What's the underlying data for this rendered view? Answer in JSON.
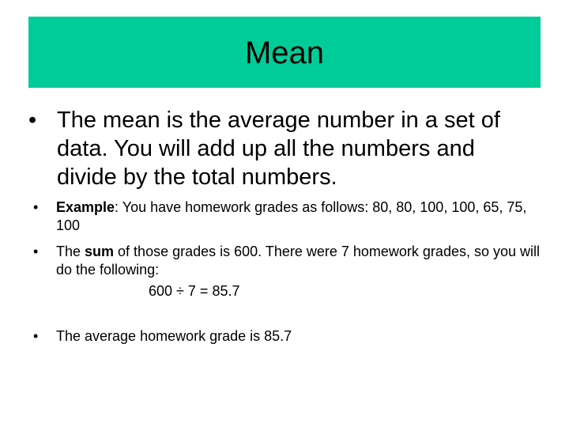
{
  "slide": {
    "title": "Mean",
    "title_bg_color": "#00CC99",
    "bullet_glyph": "•",
    "main_bullet": "The mean is the average number in a set of data.  You will add up all the numbers and divide by the total numbers.",
    "example": {
      "label": "Example",
      "text": ":  You have homework grades as follows:     80, 80, 100, 100, 65, 75, 100"
    },
    "sum_bullet": {
      "pre": "The ",
      "bold": "sum",
      "post": " of those grades is 600.  There were 7 homework grades, so you will do the following:"
    },
    "equation": "600 ÷ 7 = 85.7",
    "conclusion": "The average homework grade is  85.7"
  }
}
